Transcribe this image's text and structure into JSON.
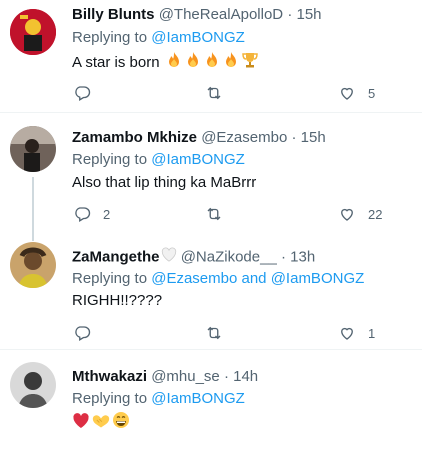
{
  "tweets": [
    {
      "display_name": "Billy Blunts",
      "handle": "@TheRealApolloD",
      "time": "15h",
      "replying_label": "Replying to",
      "replying_to": "@IamBONGZ",
      "replying_joiner": "",
      "replying_to_2": "",
      "text": "A star is born",
      "emojis": [
        "fire",
        "fire",
        "fire",
        "fire",
        "trophy"
      ],
      "reply_count": "",
      "retweet_count": "",
      "like_count": "5"
    },
    {
      "display_name": "Zamambo Mkhize",
      "handle": "@Ezasembo",
      "time": "15h",
      "replying_label": "Replying to",
      "replying_to": "@IamBONGZ",
      "replying_joiner": "",
      "replying_to_2": "",
      "text": "Also that lip thing ka MaBrrr",
      "emojis": [],
      "reply_count": "2",
      "retweet_count": "",
      "like_count": "22"
    },
    {
      "display_name": "ZaMangethe",
      "handle": "@NaZikode__",
      "time": "13h",
      "replying_label": "Replying to",
      "replying_to": "@Ezasembo",
      "replying_joiner": "and",
      "replying_to_2": "@IamBONGZ",
      "text": "RIGHH!!????",
      "emojis": [],
      "reply_count": "",
      "retweet_count": "",
      "like_count": "1"
    },
    {
      "display_name": "Mthwakazi",
      "handle": "@mhu_se",
      "time": "14h",
      "replying_label": "Replying to",
      "replying_to": "@IamBONGZ",
      "replying_joiner": "",
      "replying_to_2": "",
      "text": "",
      "emojis": [
        "red-heart",
        "handshake-heart",
        "grinning-face"
      ],
      "reply_count": "",
      "retweet_count": "",
      "like_count": ""
    }
  ],
  "icons": {
    "reply": "reply-icon",
    "retweet": "retweet-icon",
    "like": "like-icon"
  },
  "colors": {
    "accent": "#1d9bf0",
    "muted": "#536471",
    "text": "#0f1419",
    "divider": "#eff3f4"
  }
}
